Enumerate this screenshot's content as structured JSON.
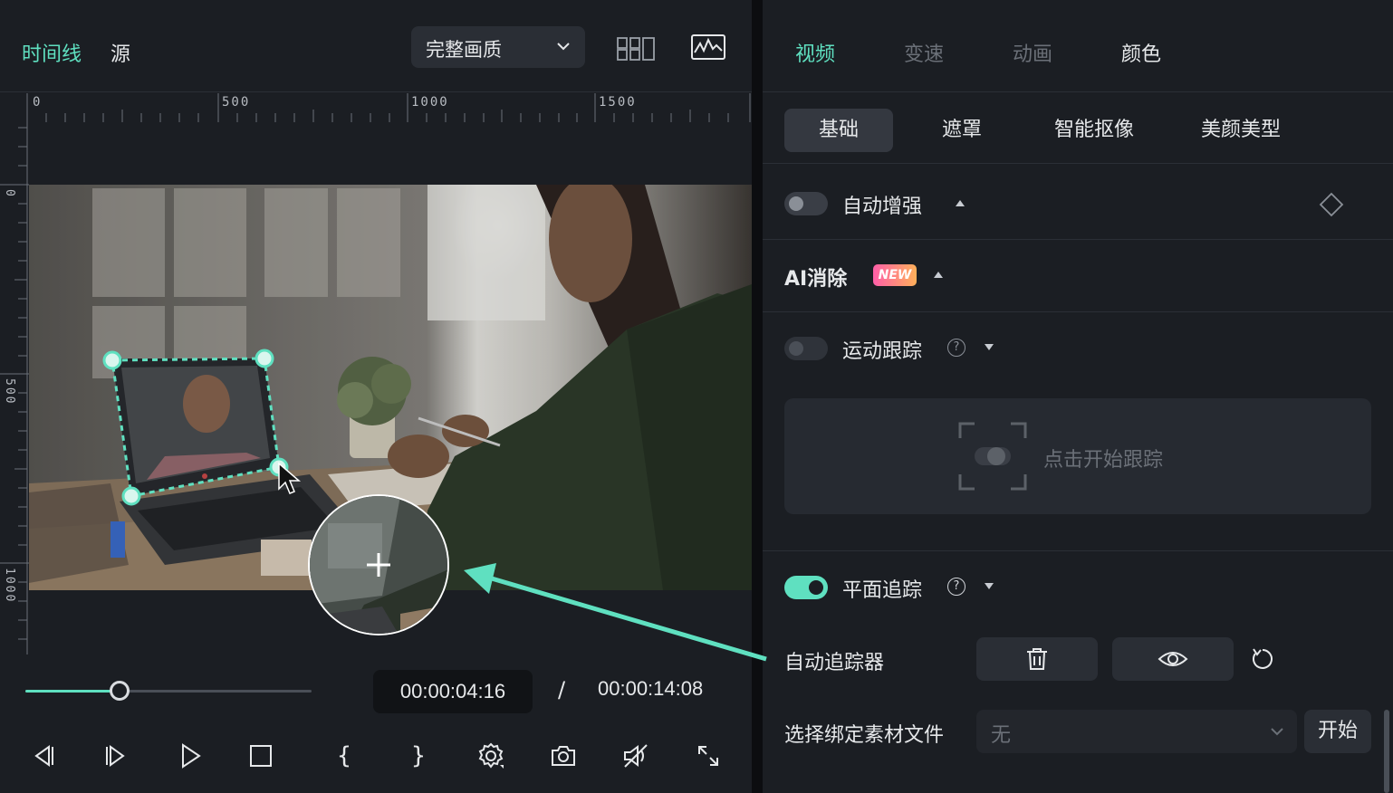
{
  "left_panel": {
    "tabs": {
      "timeline": "时间线",
      "source": "源"
    },
    "quality_select": {
      "value": "完整画质"
    },
    "icons": {
      "layout": "grid-layout-icon",
      "scope": "waveform-scope-icon"
    },
    "ruler": {
      "top_labels": [
        "0",
        "500",
        "1000",
        "1500"
      ],
      "left_labels": [
        "0",
        "500",
        "1000"
      ]
    },
    "playback": {
      "progress": 0.33,
      "current_time": "00:00:04:16",
      "separator": "/",
      "total_time": "00:00:14:08"
    },
    "controls": {
      "in_brace": "{",
      "out_brace": "}",
      "icons": [
        "prev-frame-icon",
        "next-frame-icon",
        "play-icon",
        "stop-icon",
        "mark-in-icon",
        "mark-out-icon",
        "settings-icon",
        "snapshot-icon",
        "audio-mute-icon",
        "fullscreen-icon"
      ]
    }
  },
  "right_panel": {
    "tabs": [
      {
        "label": "视频",
        "active": true
      },
      {
        "label": "变速",
        "active": false
      },
      {
        "label": "动画",
        "active": false
      },
      {
        "label": "颜色",
        "active": false
      }
    ],
    "subtabs": [
      {
        "label": "基础",
        "active": true
      },
      {
        "label": "遮罩",
        "active": false
      },
      {
        "label": "智能抠像",
        "active": false
      },
      {
        "label": "美颜美型",
        "active": false
      }
    ],
    "auto_enhance": {
      "label": "自动增强",
      "enabled": false
    },
    "ai_remove": {
      "label": "AI消除",
      "badge": "NEW"
    },
    "motion_track": {
      "label": "运动跟踪",
      "enabled": false,
      "help": "?",
      "placeholder": "点击开始跟踪"
    },
    "planar_track": {
      "label": "平面追踪",
      "enabled": true,
      "help": "?"
    },
    "auto_tracker": {
      "label": "自动追踪器"
    },
    "bind_file": {
      "label": "选择绑定素材文件",
      "value": "无",
      "start_label": "开始"
    }
  },
  "colors": {
    "accent": "#5fe0c0",
    "panel_bg": "#1b1e23",
    "badge_gradient_start": "#ff5fa8",
    "badge_gradient_end": "#ffb05a"
  }
}
